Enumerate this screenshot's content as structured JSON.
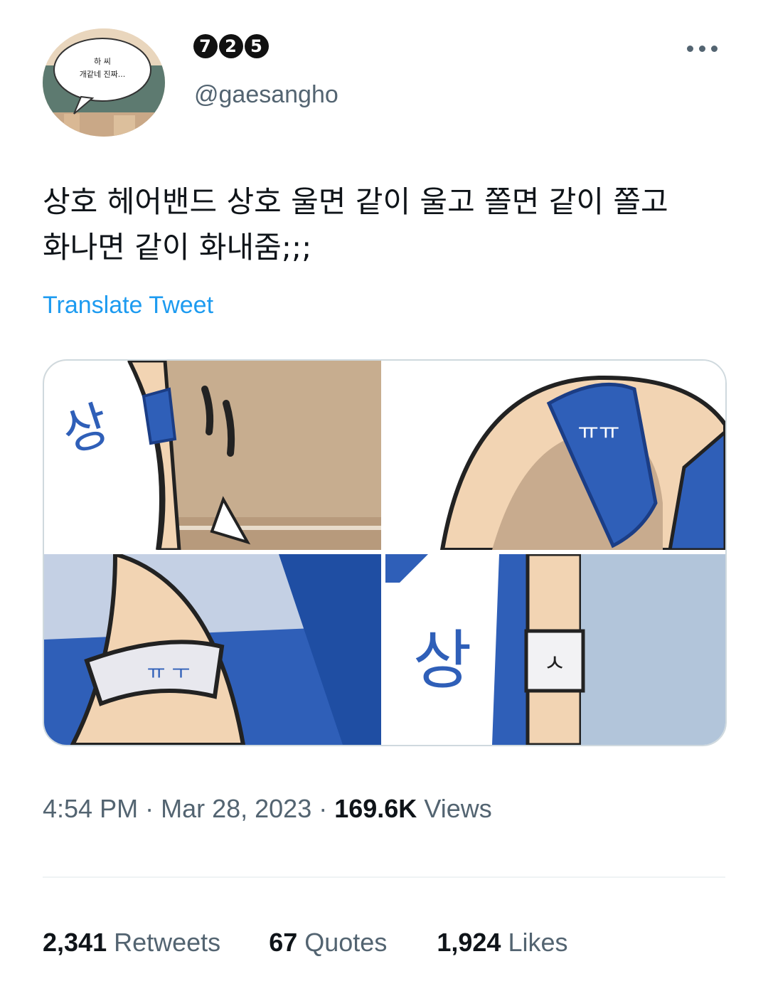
{
  "user": {
    "display_name_glyphs": [
      "7",
      "2",
      "5"
    ],
    "handle": "@gaesangho",
    "avatar_text_line1": "하 씨",
    "avatar_text_line2": "개같네 진짜..."
  },
  "menu": {
    "icon": "more-horizontal-icon"
  },
  "tweet": {
    "text": "상호 헤어밴드 상호 울면 같이 울고 쫄면 같이 쫄고\n화나면 같이 화내줌;;;",
    "translate_label": "Translate Tweet"
  },
  "media": {
    "images": [
      {
        "name": "headband-image-1",
        "text": "상"
      },
      {
        "name": "headband-image-2",
        "text": "ㅠㅠ"
      },
      {
        "name": "headband-image-3",
        "text": "ㅠ ㅜ"
      },
      {
        "name": "headband-image-4",
        "text": "상"
      }
    ],
    "band_text_4": "ㅅ"
  },
  "meta": {
    "time": "4:54 PM",
    "date": "Mar 28, 2023",
    "views_count": "169.6K",
    "views_label": "Views"
  },
  "stats": {
    "retweets_count": "2,341",
    "retweets_label": "Retweets",
    "quotes_count": "67",
    "quotes_label": "Quotes",
    "likes_count": "1,924",
    "likes_label": "Likes"
  },
  "colors": {
    "accent": "#1d9bf0",
    "secondary_text": "#536471",
    "primary_text": "#0f1419",
    "jersey_blue": "#2f5fb8"
  }
}
